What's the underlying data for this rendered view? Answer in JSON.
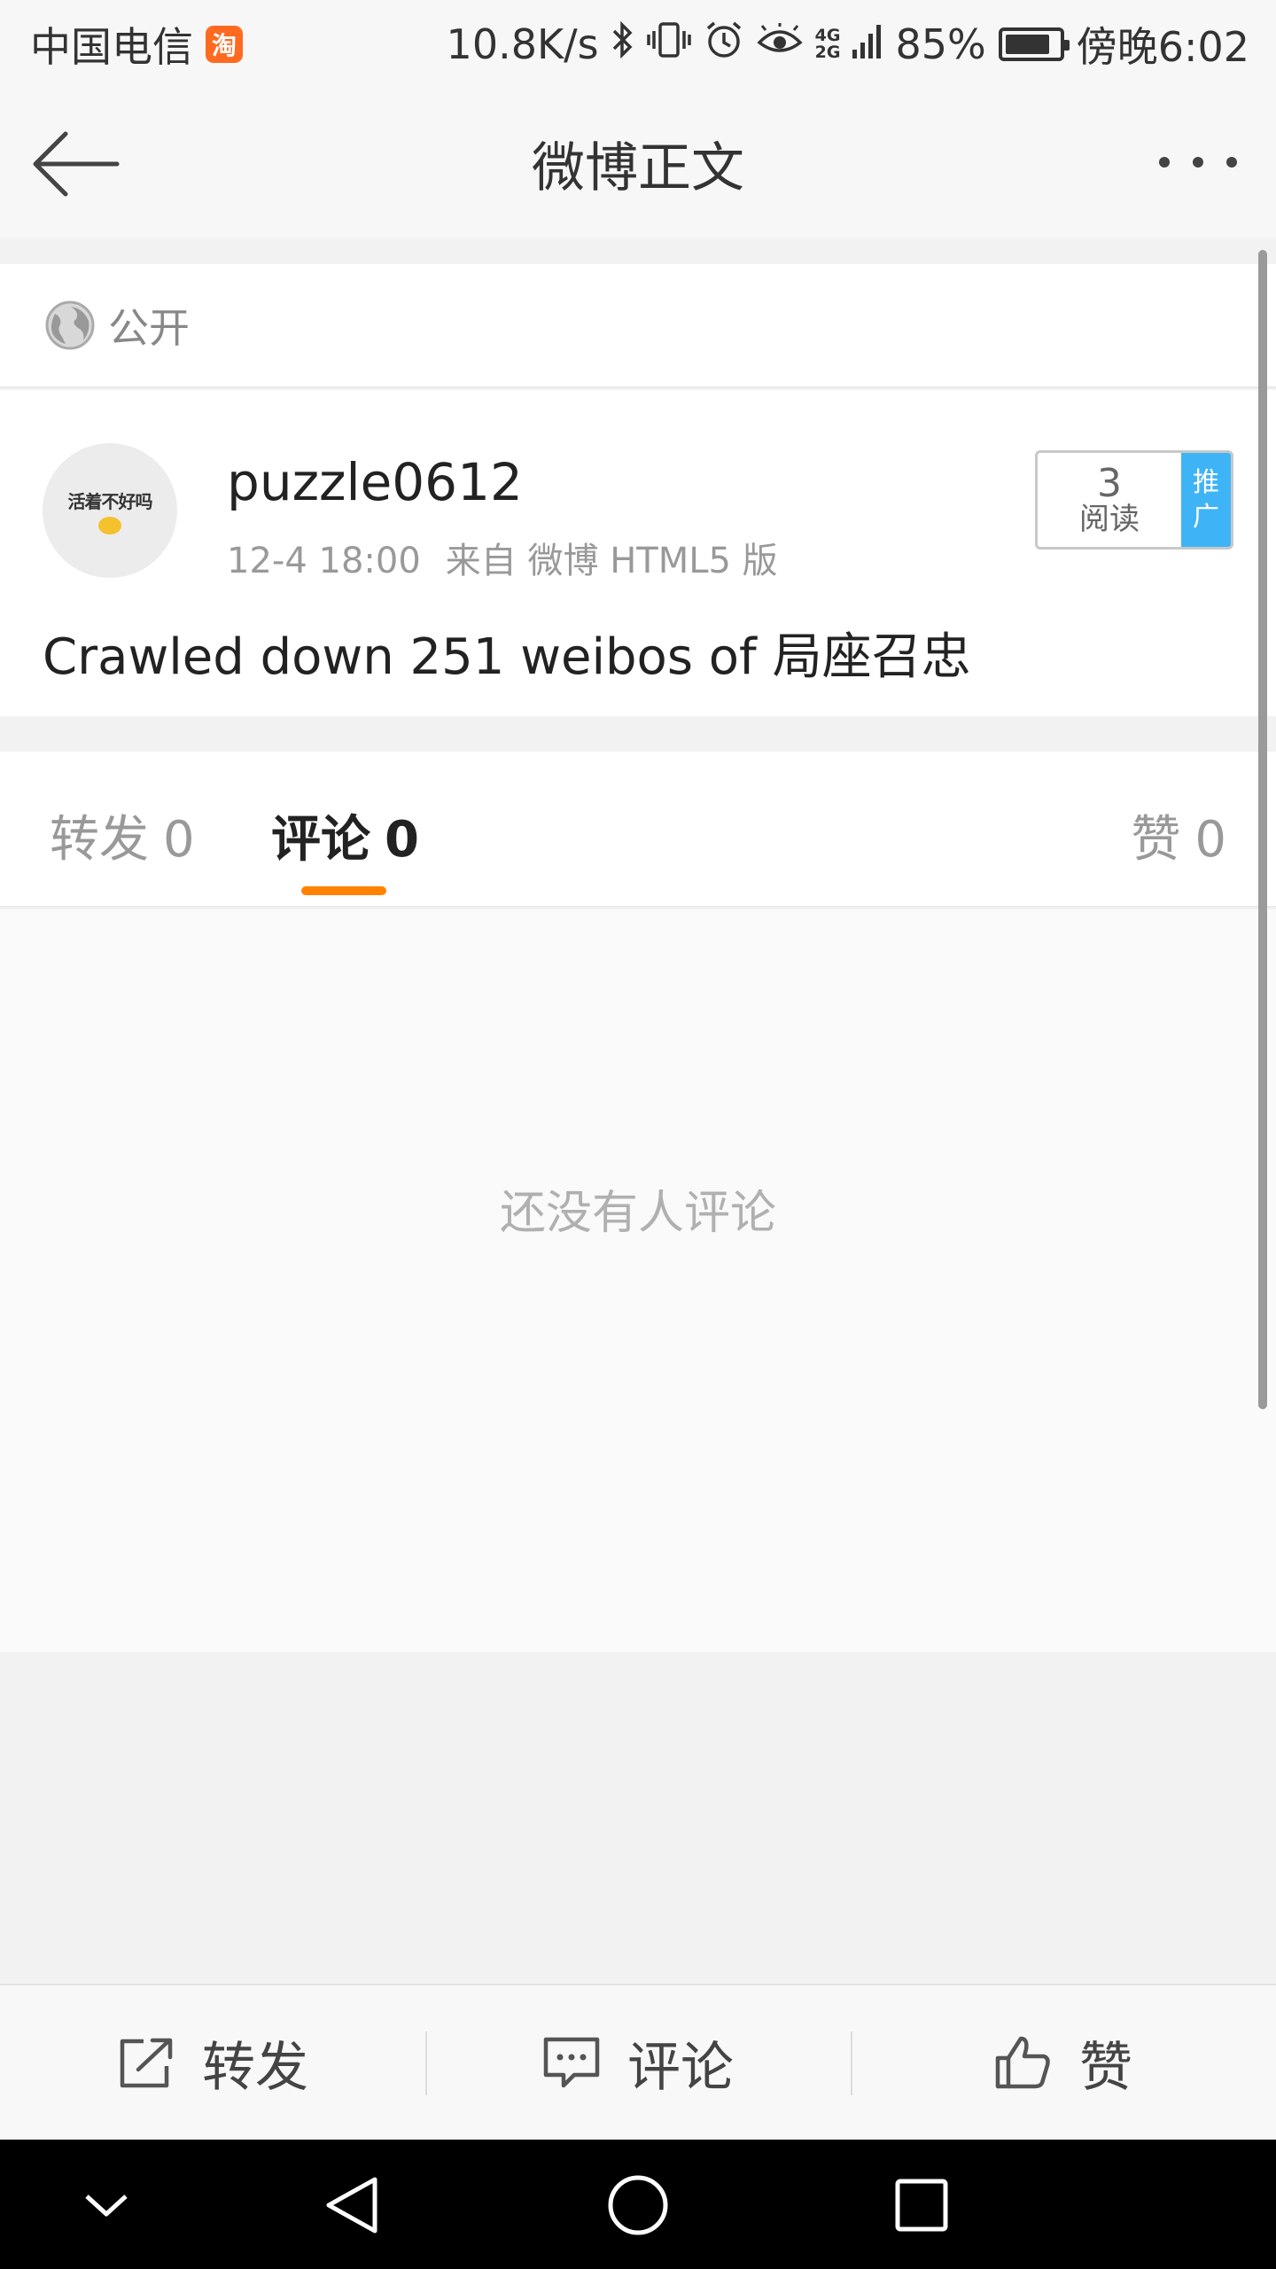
{
  "status_bar": {
    "carrier": "中国电信",
    "taobao_badge": "淘",
    "net_speed": "10.8K/s",
    "net_type_top": "4G",
    "net_type_bottom": "2G",
    "battery_percent": "85%",
    "battery_level": 0.85,
    "time": "傍晚6:02",
    "icons": [
      "taobao-icon",
      "bluetooth-icon",
      "vibrate-icon",
      "alarm-icon",
      "eye-icon",
      "signal-icon",
      "battery-icon"
    ]
  },
  "nav": {
    "title": "微博正文",
    "back_icon": "arrow-left-icon",
    "more_icon": "more-dots-icon"
  },
  "visibility": {
    "icon": "globe-icon",
    "label": "公开"
  },
  "post": {
    "avatar_text": "活着不好吗",
    "username": "puzzle0612",
    "time": "12-4 18:00",
    "source": "来自 微博 HTML5 版",
    "read_count": "3",
    "read_label": "阅读",
    "promote_line1": "推",
    "promote_line2": "广",
    "text": "Crawled down 251 weibos of 局座召忠"
  },
  "tabs": [
    {
      "label": "转发",
      "count": "0"
    },
    {
      "label": "评论",
      "count": "0"
    },
    {
      "label": "赞",
      "count": "0"
    }
  ],
  "active_tab": "评论",
  "comments": {
    "empty_text": "还没有人评论"
  },
  "actions": [
    {
      "label": "转发",
      "icon": "share-icon"
    },
    {
      "label": "评论",
      "icon": "comment-icon"
    },
    {
      "label": "赞",
      "icon": "thumbs-up-icon"
    }
  ],
  "colors": {
    "accent": "#ff8200",
    "promote_blue": "#3eb4f7",
    "taobao_orange": "#ff6a21"
  },
  "system_nav": [
    "collapse-icon",
    "back-triangle-icon",
    "home-circle-icon",
    "recents-square-icon"
  ]
}
